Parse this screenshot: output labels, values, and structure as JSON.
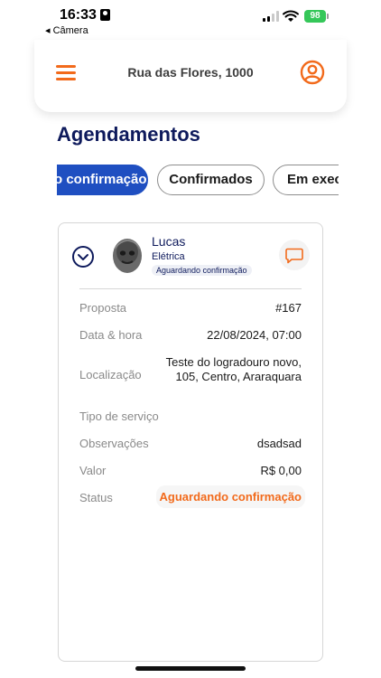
{
  "status_bar": {
    "time": "16:33",
    "back_label": "◂ Câmera",
    "battery": "98",
    "battery_color": "#35c759"
  },
  "header": {
    "address": "Rua das Flores, 1000",
    "menu_icon": "hamburger-menu-icon",
    "profile_icon": "user-circle-icon",
    "accent_color": "#f26a1b"
  },
  "page": {
    "title": "Agendamentos"
  },
  "tabs": [
    {
      "label": "o confirmação",
      "active": true
    },
    {
      "label": "Confirmados",
      "active": false
    },
    {
      "label": "Em exec",
      "active": false
    }
  ],
  "card": {
    "name": "Lucas",
    "category": "Elétrica",
    "status_badge": "Aguardando confirmação",
    "expand_icon": "chevron-down-icon",
    "chat_icon": "chat-bubble-icon",
    "details": {
      "proposta_label": "Proposta",
      "proposta_value": "#167",
      "datahora_label": "Data & hora",
      "datahora_value": "22/08/2024, 07:00",
      "localizacao_label": "Localização",
      "localizacao_line1": "Teste do logradouro novo,",
      "localizacao_line2": "105, Centro, Araraquara",
      "tipo_label": "Tipo de serviço",
      "tipo_value": "",
      "obs_label": "Observações",
      "obs_value": "dsadsad",
      "valor_label": "Valor",
      "valor_value": "R$ 0,00",
      "status_label": "Status",
      "status_value": "Aguardando confirmação"
    }
  },
  "colors": {
    "primary_navy": "#0e1a5c",
    "active_tab": "#1f4fc1",
    "orange": "#f26a1b"
  }
}
